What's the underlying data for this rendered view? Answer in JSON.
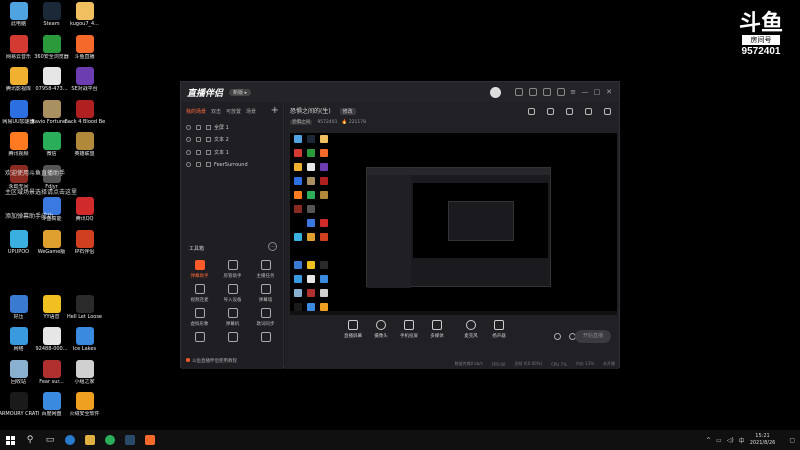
{
  "desktop": {
    "icons": [
      {
        "label": "此电脑",
        "color": "#4fa3e0"
      },
      {
        "label": "Steam",
        "color": "#1b2838"
      },
      {
        "label": "kugou7_4...",
        "color": "#f0c060"
      },
      {
        "label": "网易云音乐",
        "color": "#d33a31"
      },
      {
        "label": "360安全浏览器",
        "color": "#2a9a3a"
      },
      {
        "label": "斗鱼直播",
        "color": "#f56a2a"
      },
      {
        "label": "腾讯影视库",
        "color": "#f0b030"
      },
      {
        "label": "07958-473...",
        "color": "#e6e6e6"
      },
      {
        "label": "SE对战平台",
        "color": "#6b3db0"
      },
      {
        "label": "网易UU加速器",
        "color": "#2c6fe0"
      },
      {
        "label": "Ravio Fortune -...",
        "color": "#a89060"
      },
      {
        "label": "Back 4 Blood Beta",
        "color": "#b02020"
      },
      {
        "label": "腾讯视频",
        "color": "#ff7a20"
      },
      {
        "label": "微信",
        "color": "#2aae5a"
      },
      {
        "label": "英雄联盟",
        "color": "#b08a3a"
      },
      {
        "label": "永劫无间",
        "color": "#8a2a20"
      },
      {
        "label": "Fdjyr",
        "color": "#555555"
      },
      {
        "label": "",
        "color": "#000000"
      },
      {
        "label": "",
        "color": "#000000"
      },
      {
        "label": "斗鱼高能",
        "color": "#3a7ae0"
      },
      {
        "label": "腾讯QQ",
        "color": "#d02a2a"
      },
      {
        "label": "UPUPOO",
        "color": "#3ab0e0"
      },
      {
        "label": "WeGame版",
        "color": "#e0a030"
      },
      {
        "label": "IP石伴侣",
        "color": "#d04020"
      },
      {
        "label": "",
        "color": "#000000"
      },
      {
        "label": "",
        "color": "#000000"
      },
      {
        "label": "",
        "color": "#000000"
      },
      {
        "label": "好压",
        "color": "#3a7ad0"
      },
      {
        "label": "YY语音",
        "color": "#f0c020"
      },
      {
        "label": "Hell Let Loose",
        "color": "#2a2a2a"
      },
      {
        "label": "网络",
        "color": "#3a9ae0"
      },
      {
        "label": "92488-000...",
        "color": "#e6e6e6"
      },
      {
        "label": "Ice Lakes",
        "color": "#3a8ae0"
      },
      {
        "label": "回收站",
        "color": "#8ab0d0"
      },
      {
        "label": "Fear sur...",
        "color": "#b03030"
      },
      {
        "label": "小组之家",
        "color": "#d0d0d0"
      },
      {
        "label": "ARMOURY CRATE",
        "color": "#1a1a1a"
      },
      {
        "label": "百度网盘",
        "color": "#3a8ae0"
      },
      {
        "label": "火绒安全软件",
        "color": "#f0a020"
      }
    ],
    "notices": [
      "欢迎使用斗鱼直播助手",
      "主区域场景选择请点击这里",
      "添加弹幕助手成功"
    ]
  },
  "watermark": {
    "logo": "斗鱼",
    "sub": "房间号",
    "room_number": "9572401"
  },
  "app": {
    "brand": "直播伴侣",
    "version_pill": "新版 ▸",
    "scene_tabs": [
      "我的场景",
      "双击",
      "可放置",
      "场景"
    ],
    "sources": [
      "全屏 1",
      "文本 2",
      "文本 1",
      "FeerSurround"
    ],
    "toolbox_title": "工具箱",
    "tools": [
      {
        "label": "弹幕助手",
        "hot": true
      },
      {
        "label": "房管助手",
        "hot": false
      },
      {
        "label": "主播任务",
        "hot": false
      },
      {
        "label": "视频连麦",
        "hot": false
      },
      {
        "label": "导入设备",
        "hot": false
      },
      {
        "label": "弹幕墙",
        "hot": false
      },
      {
        "label": "虚拟形象",
        "hot": false
      },
      {
        "label": "弹幕机",
        "hot": false
      },
      {
        "label": "歌词同步",
        "hot": false
      },
      {
        "label": "",
        "hot": false
      },
      {
        "label": "",
        "hot": false
      },
      {
        "label": "",
        "hot": false
      }
    ],
    "side_tip": "斗鱼直播伴侣使用教程",
    "room": {
      "title": "恐惧之间的(生)",
      "edit_label": "修改",
      "category": "恐惧之间",
      "room_id": "9572401",
      "heat": "221178"
    },
    "controls": [
      "直播屏幕",
      "摄像头",
      "手机投屏",
      "多媒体",
      "麦克风",
      "扬声器"
    ],
    "start_button": "开始直播",
    "status": [
      "数据传输0 kb/s",
      "FPS:60",
      "丢帧 0(0.00%)",
      "CPU 7%",
      "内存 13%",
      "未开播"
    ]
  },
  "taskbar": {
    "tray_text": "中",
    "time": "15:21",
    "date": "2021/8/26"
  }
}
